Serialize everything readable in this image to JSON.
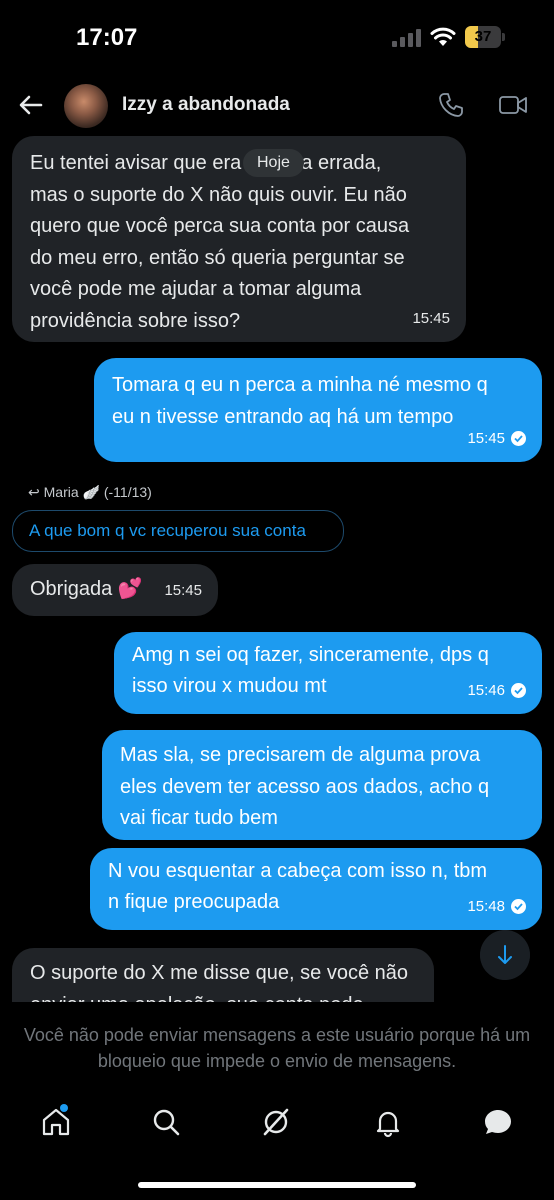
{
  "status_bar": {
    "time": "17:07",
    "battery": "37",
    "battery_level": 0.37,
    "battery_color": "#f2c94c"
  },
  "header": {
    "title": "Izzy a abandonada",
    "avatar": "profile-photo"
  },
  "date_separator": "Hoje",
  "messages": [
    {
      "dir": "in",
      "lines": [
        "Eu tentei avisar que era a conta errada,",
        "mas o suporte do X não quis ouvir. Eu não",
        "quero que você perca sua conta por causa",
        "do meu erro, então só queria perguntar se",
        "você pode me ajudar a tomar alguma",
        "providência sobre isso?"
      ],
      "time": "15:45"
    },
    {
      "dir": "out",
      "lines": [
        "Tomara q eu n perca a minha né mesmo q",
        "eu n tivesse entrando aq há um tempo"
      ],
      "time": "15:45"
    },
    {
      "dir": "in",
      "lines": [
        "Obrigada 💕"
      ],
      "time": "15:45"
    },
    {
      "dir": "out",
      "lines": [
        "Amg n sei oq fazer, sinceramente, dps q",
        "isso virou x mudou mt"
      ],
      "time": "15:46"
    },
    {
      "dir": "out",
      "lines": [
        "Mas sla, se precisarem de alguma prova",
        "eles devem ter acesso aos dados, acho q",
        "vai ficar tudo bem"
      ],
      "time": ""
    },
    {
      "dir": "out",
      "lines": [
        "N vou esquentar a cabeça com isso n, tbm",
        "n fique preocupada"
      ],
      "time": "15:48"
    },
    {
      "dir": "in",
      "lines": [
        "O suporte do X me disse que, se você não",
        "enviar uma apelação, sua conta pode"
      ],
      "time": ""
    }
  ],
  "reply": {
    "ref": "Maria 🪽 (-11/13)",
    "quoted": "A que bom q vc recuperou sua conta"
  },
  "blocked_note": "Você não pode enviar mensagens a este usuário porque há um bloqueio que impede o envio de mensagens.",
  "tabs": [
    "home-icon",
    "search-icon",
    "grok-icon",
    "notifications-icon",
    "messages-icon"
  ],
  "colors": {
    "accent": "#1d9bf0",
    "incoming_bubble": "#202327",
    "background": "#000000"
  }
}
